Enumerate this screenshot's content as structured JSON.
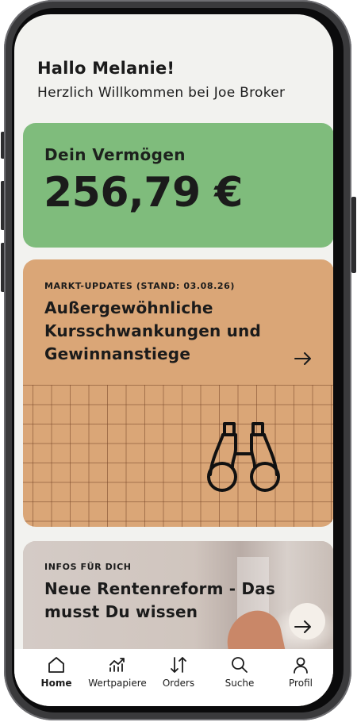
{
  "greeting": {
    "title": "Hallo Melanie!",
    "subtitle": "Herzlich Willkommen bei Joe Broker"
  },
  "assets": {
    "label": "Dein Vermögen",
    "value": "256,79 €"
  },
  "market_card": {
    "kicker": "MARKT-UPDATES (STAND: 03.08.26)",
    "headline": "Außergewöhnliche Kursschwankungen und Gewinnanstiege",
    "icon": "binoculars-icon"
  },
  "news_card": {
    "kicker": "INFOS FÜR DICH",
    "headline": "Neue Rentenreform - Das musst Du wissen"
  },
  "tabs": [
    {
      "label": "Home",
      "icon": "home-icon",
      "active": true
    },
    {
      "label": "Wertpapiere",
      "icon": "chart-icon",
      "active": false
    },
    {
      "label": "Orders",
      "icon": "orders-icon",
      "active": false
    },
    {
      "label": "Suche",
      "icon": "search-icon",
      "active": false
    },
    {
      "label": "Profil",
      "icon": "profile-icon",
      "active": false
    }
  ],
  "colors": {
    "assets_card": "#7fbc7c",
    "market_card": "#daa677",
    "background": "#f2f2ef"
  }
}
